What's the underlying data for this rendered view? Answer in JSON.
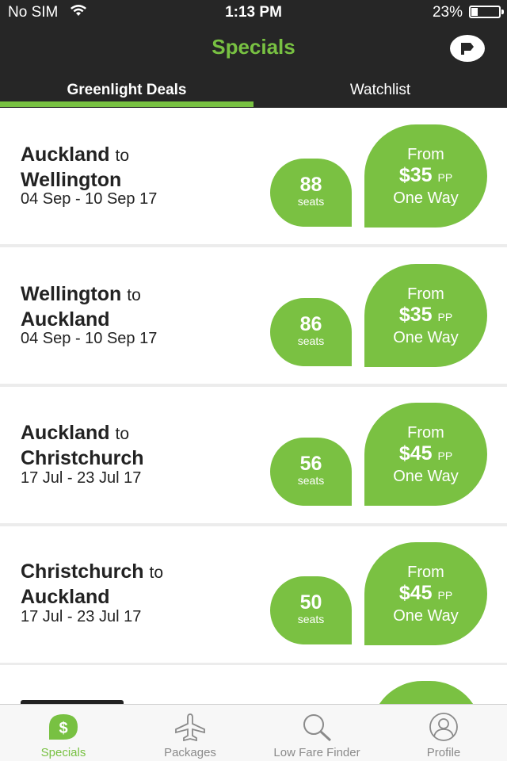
{
  "status_bar": {
    "carrier": "No SIM",
    "time": "1:13 PM",
    "battery": "23%"
  },
  "header": {
    "title": "Specials"
  },
  "tabs": [
    {
      "label": "Greenlight Deals"
    },
    {
      "label": "Watchlist"
    }
  ],
  "deals": [
    {
      "from_city": "Auckland",
      "connector": "to",
      "to_city": "Wellington",
      "dates": "04 Sep - 10 Sep 17",
      "seats": "88",
      "seats_label": "seats",
      "from_label": "From",
      "price": "$35",
      "pp": "PP",
      "trip": "One Way"
    },
    {
      "from_city": "Wellington",
      "connector": "to",
      "to_city": "Auckland",
      "dates": "04 Sep - 10 Sep 17",
      "seats": "86",
      "seats_label": "seats",
      "from_label": "From",
      "price": "$35",
      "pp": "PP",
      "trip": "One Way"
    },
    {
      "from_city": "Auckland",
      "connector": "to",
      "to_city": "Christchurch",
      "dates": "17 Jul - 23 Jul 17",
      "seats": "56",
      "seats_label": "seats",
      "from_label": "From",
      "price": "$45",
      "pp": "PP",
      "trip": "One Way"
    },
    {
      "from_city": "Christchurch",
      "connector": "to",
      "to_city": "Auckland",
      "dates": "17 Jul - 23 Jul 17",
      "seats": "50",
      "seats_label": "seats",
      "from_label": "From",
      "price": "$45",
      "pp": "PP",
      "trip": "One Way"
    }
  ],
  "tab_bar": [
    {
      "label": "Specials",
      "icon": "dollar-icon",
      "active": true
    },
    {
      "label": "Packages",
      "icon": "plane-icon",
      "active": false
    },
    {
      "label": "Low Fare Finder",
      "icon": "search-icon",
      "active": false
    },
    {
      "label": "Profile",
      "icon": "profile-icon",
      "active": false
    }
  ],
  "colors": {
    "accent": "#78c142",
    "header_bg": "#262626"
  }
}
